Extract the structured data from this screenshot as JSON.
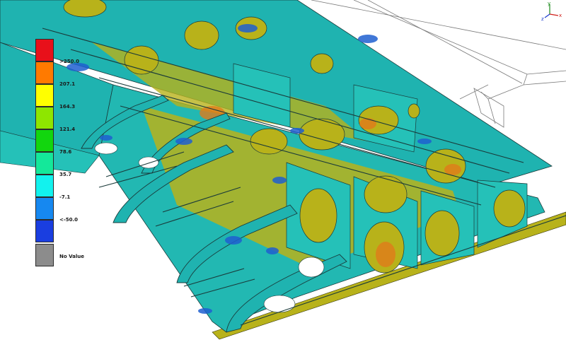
{
  "legend": {
    "bands": [
      {
        "color": "#e8101a",
        "label": ">250.0"
      },
      {
        "color": "#ff7a00",
        "label": "207.1"
      },
      {
        "color": "#ffff00",
        "label": "164.3"
      },
      {
        "color": "#8ee600",
        "label": "121.4"
      },
      {
        "color": "#12d60e",
        "label": "78.6"
      },
      {
        "color": "#14e89a",
        "label": "35.7"
      },
      {
        "color": "#12f2ee",
        "label": "-7.1"
      },
      {
        "color": "#1688f0",
        "label": "<-50.0"
      },
      {
        "color": "#1a3ee0",
        "label": ""
      }
    ],
    "no_value_label": "No Value",
    "no_value_color": "#8c8c8c"
  },
  "triad": {
    "x_label": "x",
    "y_label": "y",
    "z_label": "z"
  },
  "colors": {
    "skin": "#1fb3b0",
    "skin_dark": "#158a88",
    "rib": "#25c1b8",
    "bay_yellow": "#b8b21a",
    "hot_orange": "#e07a1a",
    "cold_blue": "#1f5fd0",
    "outline": "#1a3a3a",
    "wireframe": "#8a8a8a"
  }
}
